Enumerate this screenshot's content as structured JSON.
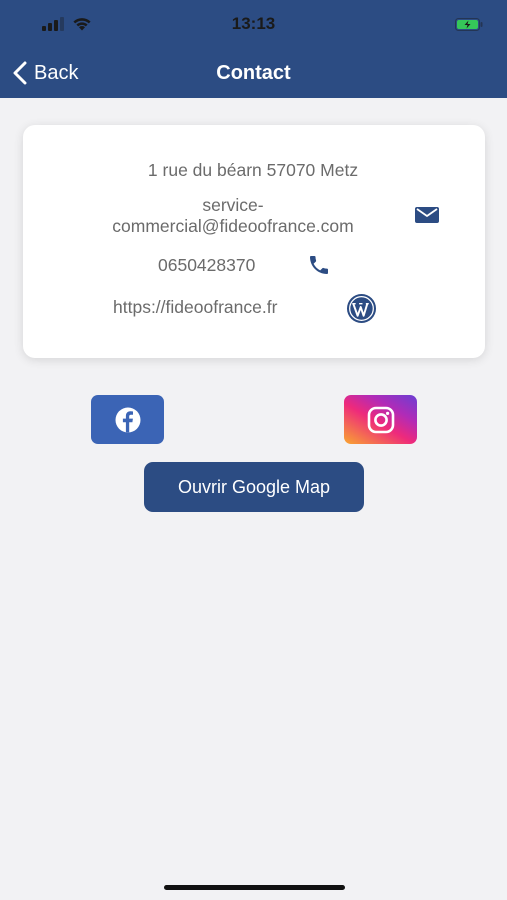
{
  "status_bar": {
    "time": "13:13"
  },
  "nav": {
    "back_label": "Back",
    "title": "Contact"
  },
  "contact": {
    "address": "1 rue du béarn 57070 Metz",
    "email_line1": "service-",
    "email_line2": "commercial@fideoofrance.com",
    "phone": "0650428370",
    "website": "https://fideoofrance.fr"
  },
  "buttons": {
    "map_label": "Ouvrir Google Map"
  },
  "icons": {
    "back": "chevron-left-icon",
    "mail": "mail-icon",
    "phone": "phone-icon",
    "website": "wordpress-icon",
    "facebook": "facebook-icon",
    "instagram": "instagram-icon"
  },
  "colors": {
    "header": "#2c4c83",
    "background": "#f2f2f4",
    "text_secondary": "#6b6b6b",
    "facebook": "#3b64b5",
    "battery": "#35c759"
  }
}
